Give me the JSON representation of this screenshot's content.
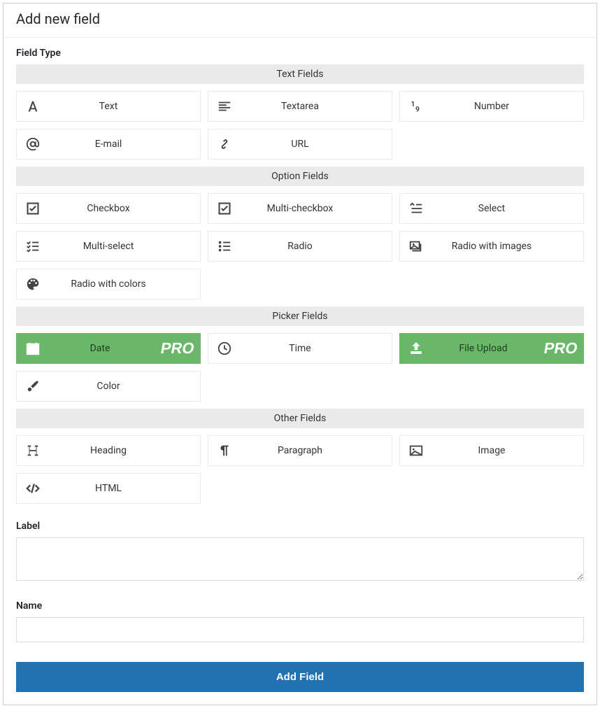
{
  "header": {
    "title": "Add new field"
  },
  "sections": {
    "field_type_label": "Field Type",
    "label_label": "Label",
    "name_label": "Name"
  },
  "groups": {
    "text": {
      "header": "Text Fields",
      "items": {
        "text": "Text",
        "textarea": "Textarea",
        "number": "Number",
        "email": "E-mail",
        "url": "URL"
      }
    },
    "option": {
      "header": "Option Fields",
      "items": {
        "checkbox": "Checkbox",
        "multi_checkbox": "Multi-checkbox",
        "select": "Select",
        "multi_select": "Multi-select",
        "radio": "Radio",
        "radio_images": "Radio with images",
        "radio_colors": "Radio with colors"
      }
    },
    "picker": {
      "header": "Picker Fields",
      "items": {
        "date": "Date",
        "time": "Time",
        "file_upload": "File Upload",
        "color": "Color"
      }
    },
    "other": {
      "header": "Other Fields",
      "items": {
        "heading": "Heading",
        "paragraph": "Paragraph",
        "image": "Image",
        "html": "HTML"
      }
    }
  },
  "pro_badge": "PRO",
  "submit": {
    "label": "Add Field"
  },
  "form": {
    "label_value": "",
    "name_value": ""
  }
}
